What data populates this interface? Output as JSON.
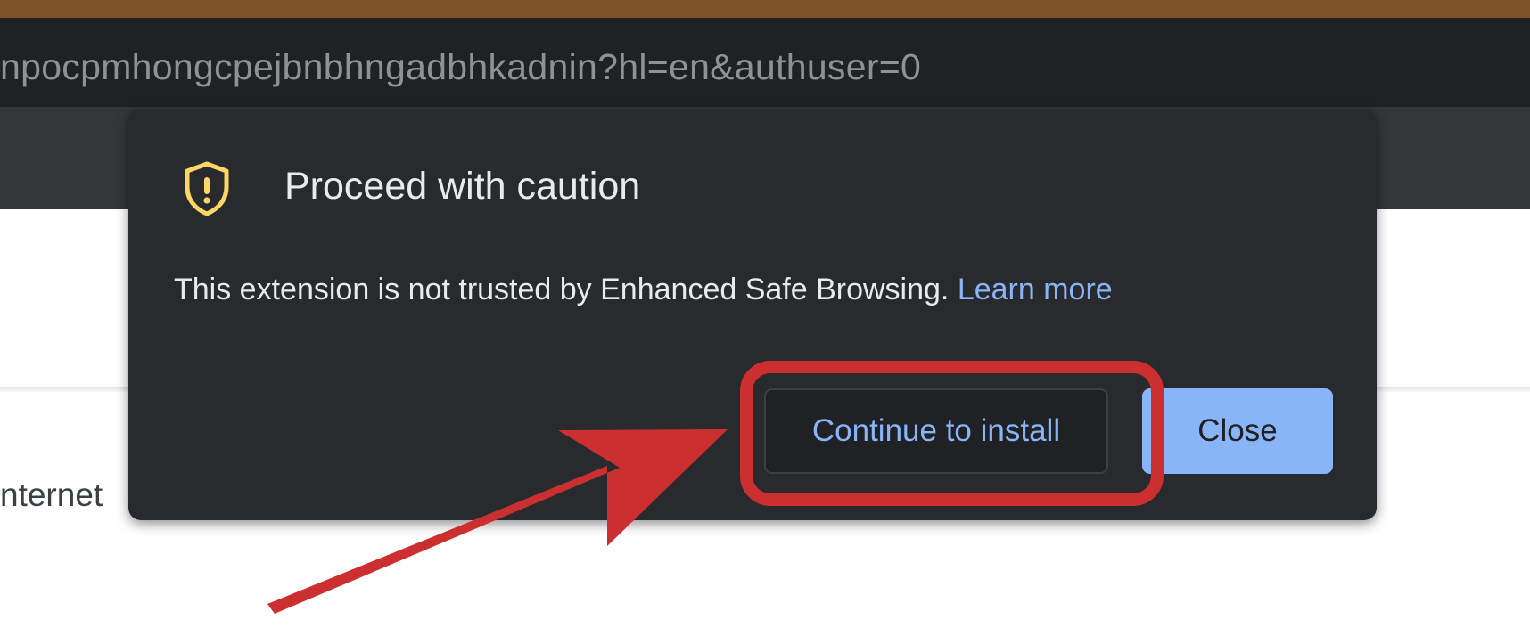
{
  "browser": {
    "url_fragment": "npocpmhongcpejbnbhngadbhkadnin?hl=en&authuser=0"
  },
  "page": {
    "visible_text_fragment": "nternet"
  },
  "dialog": {
    "title": "Proceed with caution",
    "body": "This extension is not trusted by Enhanced Safe Browsing.",
    "learn_more": "Learn more",
    "continue_button": "Continue to install",
    "close_button": "Close",
    "icon": "shield-alert-icon"
  },
  "colors": {
    "accent": "#8ab4f8",
    "warning": "#fdd663",
    "annotation": "#cc2f2f"
  }
}
